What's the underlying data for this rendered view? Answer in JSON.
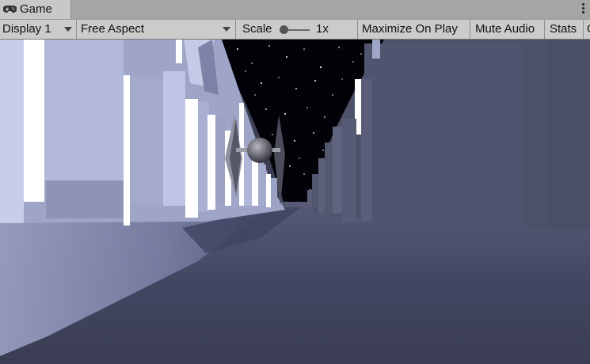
{
  "tab": {
    "label": "Game",
    "icon": "gamepad-icon"
  },
  "toolbar": {
    "display": "Display 1",
    "aspect": "Free Aspect",
    "scale_label": "Scale",
    "scale_value": "1x",
    "scale_slider_level": 0.0,
    "maximize": "Maximize On Play",
    "mute": "Mute Audio",
    "stats": "Stats",
    "gizmos": "G"
  },
  "colors": {
    "sky": "#020208",
    "wall_lit": "#b7bedf",
    "floor": "#3c3f55",
    "tab": "#c8c8c8",
    "toolbar": "#cbcbcb"
  }
}
